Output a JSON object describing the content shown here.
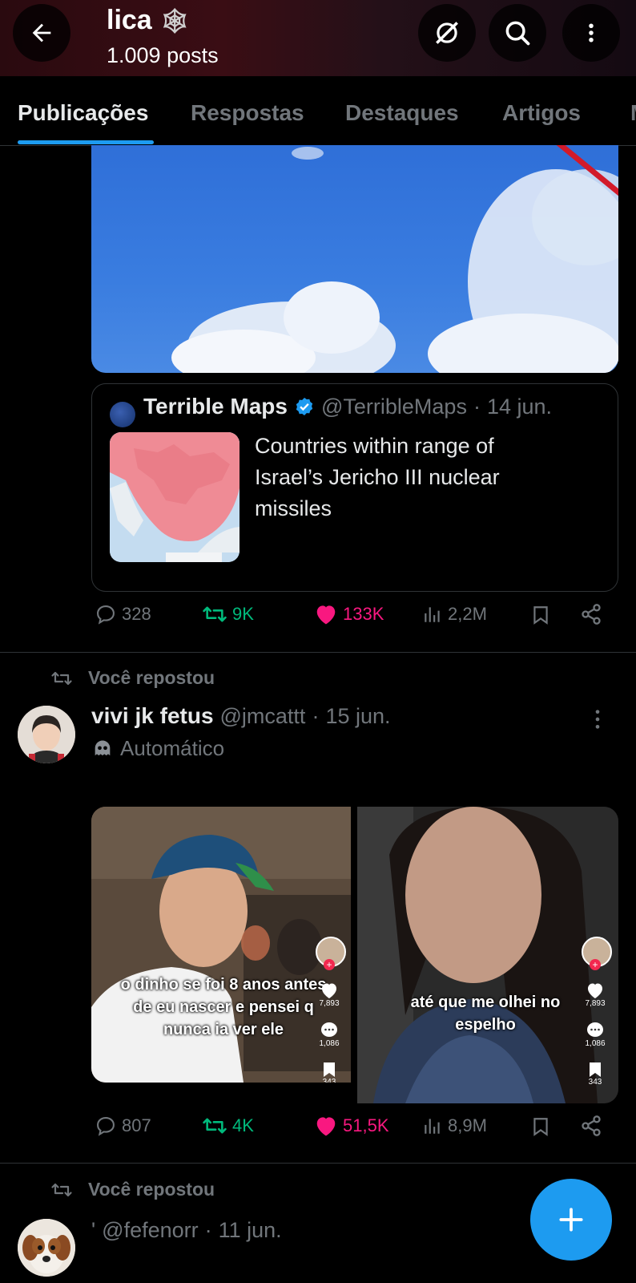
{
  "header": {
    "title": "lica",
    "title_emoji": "🕸",
    "post_count": "1.009 posts"
  },
  "tabs": [
    "Publicações",
    "Respostas",
    "Destaques",
    "Artigos",
    "M"
  ],
  "post1": {
    "quote": {
      "author": "Terrible Maps",
      "handle": "@TerribleMaps",
      "sep": "·",
      "date": "14 jun.",
      "text_line1": "Countries within range of",
      "text_line2": "Israel’s Jericho III nuclear",
      "text_line3": "missiles"
    },
    "stats": {
      "replies": "328",
      "reposts": "9K",
      "likes": "133K",
      "views": "2,2M"
    }
  },
  "post2": {
    "repost_label": "Você repostou",
    "author": "vivi jk fetus",
    "handle": "@jmcattt",
    "sep": "·",
    "date": "15 jun.",
    "automatic": "Automático",
    "media_left": {
      "caption1": "o dinho se foi 8 anos antes",
      "caption2": "de eu nascer e pensei q",
      "caption3": "nunca ia ver ele",
      "likes": "7,893",
      "comments": "1,086",
      "saves": "343"
    },
    "media_right": {
      "caption1": "até que me olhei no",
      "caption2": "espelho",
      "likes": "7,893",
      "comments": "1,086",
      "saves": "343"
    },
    "stats": {
      "replies": "807",
      "reposts": "4K",
      "likes": "51,5K",
      "views": "8,9M"
    }
  },
  "post3": {
    "repost_label": "Você repostou",
    "handle_fragment": "'",
    "handle": "@fefenorr",
    "sep": "·",
    "date": "11 jun."
  },
  "colors": {
    "accent": "#1d9bf0",
    "like": "#f91880",
    "repost": "#00ba7c",
    "muted": "#71767b"
  }
}
